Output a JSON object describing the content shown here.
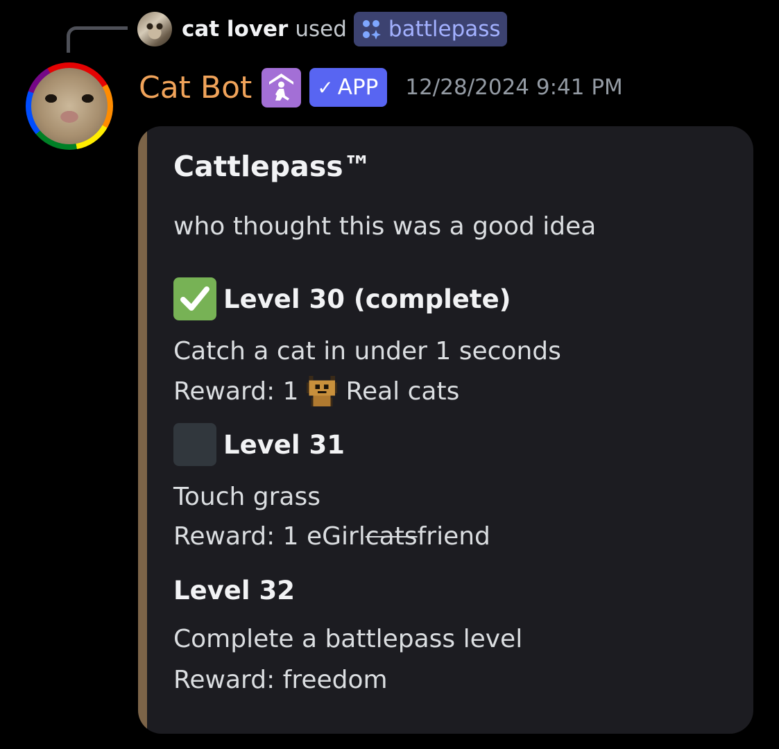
{
  "reply": {
    "username": "cat lover",
    "used_text": "used",
    "command": "battlepass"
  },
  "message": {
    "bot_name": "Cat Bot",
    "app_tag": "APP",
    "app_tag_check": "✓",
    "timestamp": "12/28/2024 9:41 PM",
    "colors": {
      "bot_name": "#f0a35a",
      "app_tag": "#5865f2",
      "embed_accent": "#7c6448",
      "command_chip": "#3c4270"
    }
  },
  "embed": {
    "title": "Cattlepass™",
    "description": "who thought this was a good idea",
    "levels": [
      {
        "status_icon": "check-mark-button-icon",
        "name": "Level 30 (complete)",
        "task": "Catch a cat in under 1 seconds",
        "reward_prefix": "Reward: 1",
        "reward_icon": "real-cat-emoji-icon",
        "reward_item": "Real cats"
      },
      {
        "status_icon": "empty-square-icon",
        "name": "Level 31",
        "task": "Touch grass",
        "reward_prefix": "Reward: 1",
        "reward_part1": "eGirl",
        "reward_struck": "cats",
        "reward_part2": "friend"
      },
      {
        "name": "Level 32",
        "task": "Complete a battlepass level",
        "reward": "Reward: freedom"
      }
    ]
  }
}
